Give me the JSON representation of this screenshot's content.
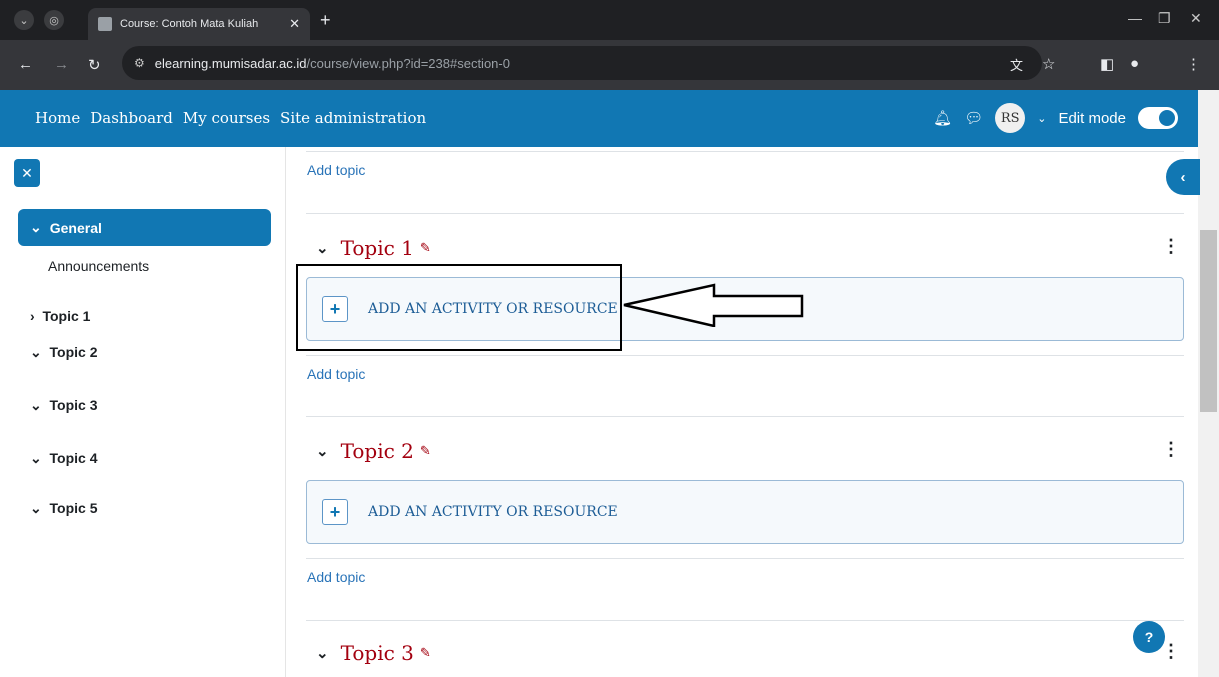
{
  "browser": {
    "tab_title": "Course: Contoh Mata Kuliah",
    "url_host": "elearning.mumisadar.ac.id",
    "url_path": "/course/view.php?id=238#section-0"
  },
  "navbar": {
    "links": [
      "Home",
      "Dashboard",
      "My courses",
      "Site administration"
    ],
    "avatar_initials": "RS",
    "edit_mode_label": "Edit mode",
    "edit_mode_on": true
  },
  "sidebar": {
    "general": "General",
    "announcements": "Announcements",
    "topics": [
      "Topic 1",
      "Topic 2",
      "Topic 3",
      "Topic 4",
      "Topic 5"
    ]
  },
  "main": {
    "add_topic_label": "Add topic",
    "add_activity_label": "ADD AN ACTIVITY OR RESOURCE",
    "sections": [
      {
        "title": "Topic 1"
      },
      {
        "title": "Topic 2"
      },
      {
        "title": "Topic 3"
      }
    ]
  },
  "colors": {
    "brand": "#1177b3",
    "topic_title": "#a3000f",
    "link": "#2a74b8"
  }
}
